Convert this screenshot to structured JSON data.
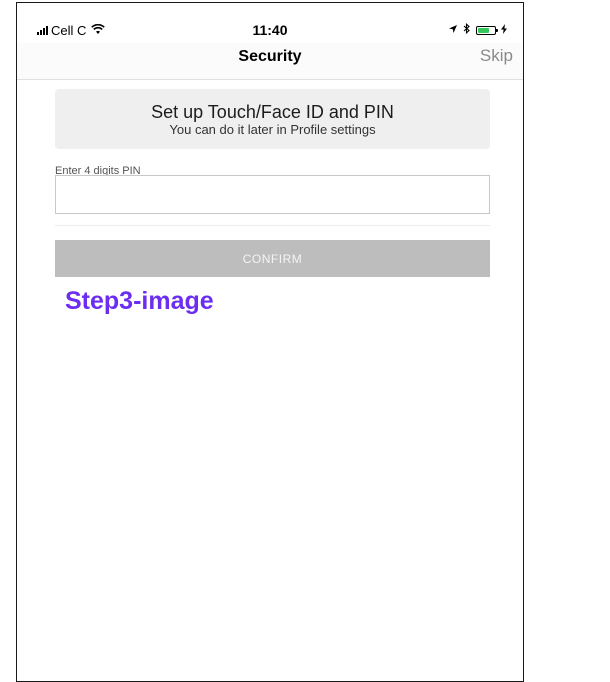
{
  "status_bar": {
    "carrier": "Cell C",
    "time": "11:40",
    "icons": [
      "signal-icon",
      "wifi-icon",
      "location-icon",
      "bluetooth-icon",
      "battery-icon",
      "charging-icon"
    ]
  },
  "nav": {
    "title": "Security",
    "skip_label": "Skip"
  },
  "info_card": {
    "title": "Set up Touch/Face ID and PIN",
    "subtitle": "You can do it later in Profile settings"
  },
  "pin": {
    "label": "Enter 4 digits PIN",
    "value": "",
    "placeholder": ""
  },
  "confirm_label": "CONFIRM",
  "step_label": "Step3-image",
  "colors": {
    "accent": "#6b2ef0",
    "button_disabled": "#bdbdbd",
    "card_bg": "#efeff0",
    "battery": "#35c759"
  }
}
